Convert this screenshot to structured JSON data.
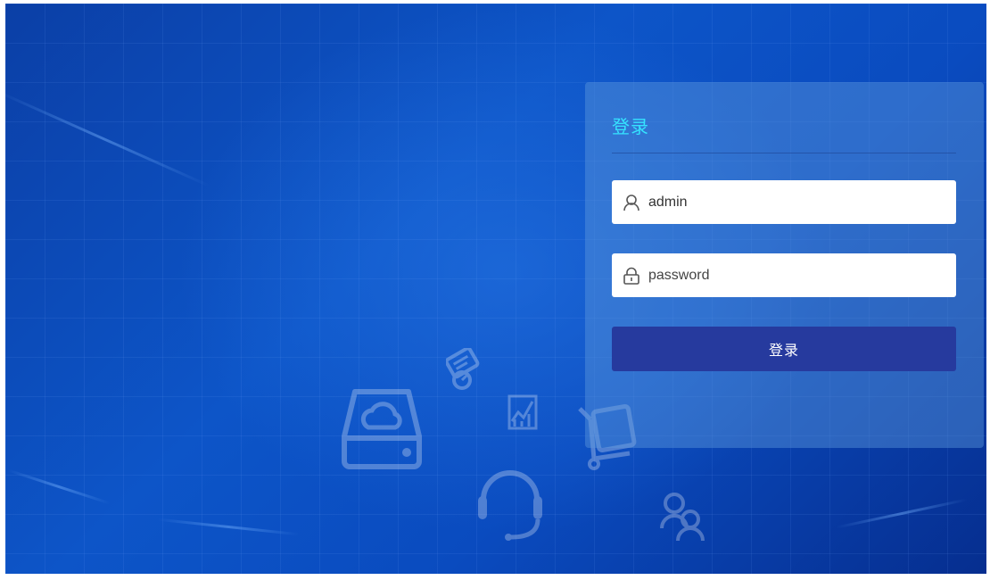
{
  "login": {
    "title": "登录",
    "username": {
      "value": "admin",
      "icon": "user-icon"
    },
    "password": {
      "placeholder": "password",
      "icon": "lock-icon"
    },
    "submit_label": "登录"
  },
  "background": {
    "decor_icons": [
      "cloud-drive-icon",
      "meter-icon",
      "chart-icon",
      "cart-icon",
      "headset-icon",
      "users-icon"
    ]
  },
  "colors": {
    "title": "#35e3ff",
    "button": "#263a9e",
    "background": "#0d55c8"
  }
}
